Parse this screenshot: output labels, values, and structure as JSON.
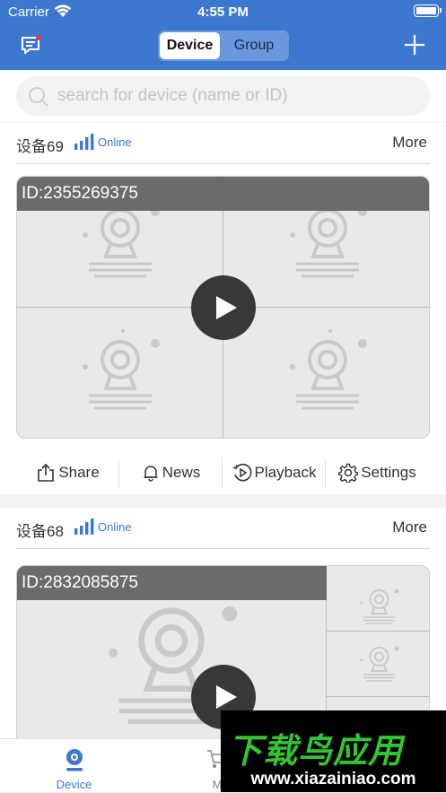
{
  "status_bar": {
    "carrier": "Carrier",
    "time": "4:55 PM"
  },
  "nav": {
    "tabs": [
      "Device",
      "Group"
    ],
    "active_tab": "Device",
    "accent": "#3d78d0"
  },
  "search": {
    "placeholder": "search for device (name or ID)"
  },
  "devices": [
    {
      "name": "设备69",
      "status": "Online",
      "more": "More",
      "id_label": "ID:2355269375",
      "layout": "2x2 grid",
      "actions": [
        "Share",
        "News",
        "Playback",
        "Settings"
      ]
    },
    {
      "name": "设备68",
      "status": "Online",
      "more": "More",
      "id_label": "ID:2832085875",
      "layout": "1 large + 3 small"
    }
  ],
  "tabbar": {
    "items": [
      "Device",
      "M"
    ],
    "active": "Device"
  },
  "watermark": {
    "title": "下载鸟应用",
    "url": "www.xiazainiao.com",
    "color": "#33c531"
  }
}
